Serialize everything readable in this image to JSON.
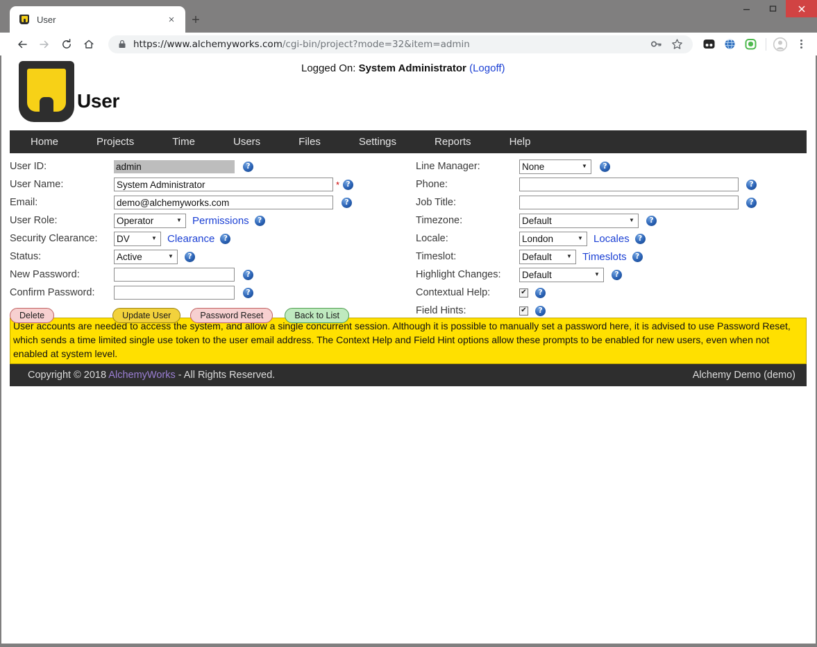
{
  "browser": {
    "tab": {
      "title": "User",
      "favicon": "alchemy-logo-icon",
      "close_label": "×"
    },
    "new_tab_label": "+",
    "window_controls": {
      "minimize": "–",
      "maximize": "☐",
      "close": "✕"
    },
    "nav": {
      "back": "←",
      "forward": "→",
      "reload": "C",
      "home": "⌂"
    },
    "url": {
      "scheme_host": "https://www.alchemyworks.com",
      "path": "/cgi-bin/project?mode=32&item=admin",
      "full": "https://www.alchemyworks.com/cgi-bin/project?mode=32&item=admin"
    },
    "omnibox_icons": [
      "lock-icon",
      "key-icon",
      "star-icon"
    ],
    "extension_icons": [
      "extension-dark-icon",
      "globe-icon",
      "shield-green-icon"
    ],
    "profile_icon": "avatar-icon",
    "menu_icon": "three-dot-menu-icon"
  },
  "header": {
    "title": "User",
    "logged_on_prefix": "Logged On:",
    "logged_on_user": "System Administrator",
    "logoff_label": "(Logoff)"
  },
  "navbar": {
    "items": [
      {
        "label": "Home"
      },
      {
        "label": "Projects"
      },
      {
        "label": "Time"
      },
      {
        "label": "Users"
      },
      {
        "label": "Files"
      },
      {
        "label": "Settings"
      },
      {
        "label": "Reports"
      },
      {
        "label": "Help"
      }
    ]
  },
  "form": {
    "left": {
      "user_id": {
        "label": "User ID:",
        "value": "admin"
      },
      "user_name": {
        "label": "User Name:",
        "value": "System Administrator",
        "required_marker": "*"
      },
      "email": {
        "label": "Email:",
        "value": "demo@alchemyworks.com"
      },
      "user_role": {
        "label": "User Role:",
        "value": "Operator",
        "link": "Permissions"
      },
      "security_clearance": {
        "label": "Security Clearance:",
        "value": "DV",
        "link": "Clearance"
      },
      "status": {
        "label": "Status:",
        "value": "Active"
      },
      "new_password": {
        "label": "New Password:",
        "value": ""
      },
      "confirm_password": {
        "label": "Confirm Password:",
        "value": ""
      }
    },
    "right": {
      "line_manager": {
        "label": "Line Manager:",
        "value": "None"
      },
      "phone": {
        "label": "Phone:",
        "value": ""
      },
      "job_title": {
        "label": "Job Title:",
        "value": ""
      },
      "timezone": {
        "label": "Timezone:",
        "value": "Default"
      },
      "locale": {
        "label": "Locale:",
        "value": "London",
        "link": "Locales"
      },
      "timeslot": {
        "label": "Timeslot:",
        "value": "Default",
        "link": "Timeslots"
      },
      "highlight_changes": {
        "label": "Highlight Changes:",
        "value": "Default"
      },
      "contextual_help": {
        "label": "Contextual Help:",
        "checked": true,
        "check_glyph": "✔"
      },
      "field_hints": {
        "label": "Field Hints:",
        "checked": true,
        "check_glyph": "✔"
      }
    },
    "buttons": {
      "delete": "Delete",
      "update": "Update User",
      "password_reset": "Password Reset",
      "back": "Back to List"
    },
    "dropdown_arrow": "▼",
    "help_glyph": "?"
  },
  "banner": {
    "text": "User accounts are needed to access the system, and allow a single concurrent session. Although it is possible to manually set a password here, it is advised to use Password Reset, which sends a time limited single use token to the user email address. The Context Help and Field Hint options allow these prompts to be enabled for new users, even when not enabled at system level."
  },
  "footer": {
    "copyright_prefix": "Copyright © 2018",
    "brand": "AlchemyWorks",
    "copyright_suffix": "- All Rights Reserved.",
    "instance": "Alchemy Demo (demo)"
  },
  "colors": {
    "accent_yellow": "#f7d117",
    "banner_yellow": "#ffe000",
    "nav_dark": "#2e2e2e",
    "link_blue": "#1a3fd4",
    "brand_purple": "#9b7fd4",
    "help_blue": "#2a62b5",
    "close_red": "#d14343"
  }
}
